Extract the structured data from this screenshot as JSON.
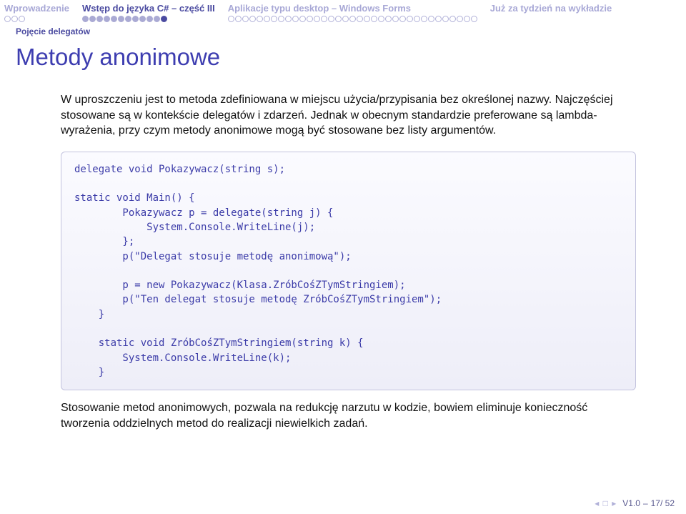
{
  "nav": {
    "sections": [
      {
        "label": "Wprowadzenie",
        "dots": [
          0,
          0,
          0
        ]
      },
      {
        "label": "Wstęp do języka C# – część III",
        "dots": [
          1,
          1,
          1,
          1,
          1,
          1,
          1,
          1,
          1,
          1,
          1,
          2
        ]
      },
      {
        "label": "Aplikacje typu desktop – Windows Forms",
        "dots": [
          0,
          0,
          0,
          0,
          0,
          0,
          0,
          0,
          0,
          0,
          0,
          0,
          0,
          0,
          0,
          0,
          0,
          0,
          0,
          0,
          0,
          0,
          0,
          0,
          0,
          0,
          0,
          0,
          0,
          0,
          0,
          0,
          0,
          0,
          0
        ]
      },
      {
        "label": "Już za tydzień na wykładzie",
        "dots": []
      }
    ],
    "activeIndex": 1
  },
  "subsubtitle": "Pojęcie delegatów",
  "title": "Metody anonimowe",
  "intro": "W uproszczeniu jest to metoda zdefiniowana w miejscu użycia/przypisania bez określonej nazwy. Najczęściej stosowane są w kontekście delegatów i zdarzeń. Jednak w obecnym standardzie preferowane są lambda-wyrażenia, przy czym metody anonimowe mogą być stosowane bez listy argumentów.",
  "code": "delegate void Pokazywacz(string s);\n\nstatic void Main() {\n        Pokazywacz p = delegate(string j) {\n            System.Console.WriteLine(j);\n        };\n        p(\"Delegat stosuje metodę anonimową\");\n\n        p = new Pokazywacz(Klasa.ZróbCośZTymStringiem);\n        p(\"Ten delegat stosuje metodę ZróbCośZTymStringiem\");\n    }\n\n    static void ZróbCośZTymStringiem(string k) {\n        System.Console.WriteLine(k);\n    }",
  "outro": "Stosowanie metod anonimowych, pozwala na redukcję narzutu w kodzie, bowiem eliminuje konieczność tworzenia oddzielnych metod do realizacji niewielkich zadań.",
  "footer": {
    "version": "V1.0",
    "sep": "–",
    "page": "17/ 52"
  }
}
